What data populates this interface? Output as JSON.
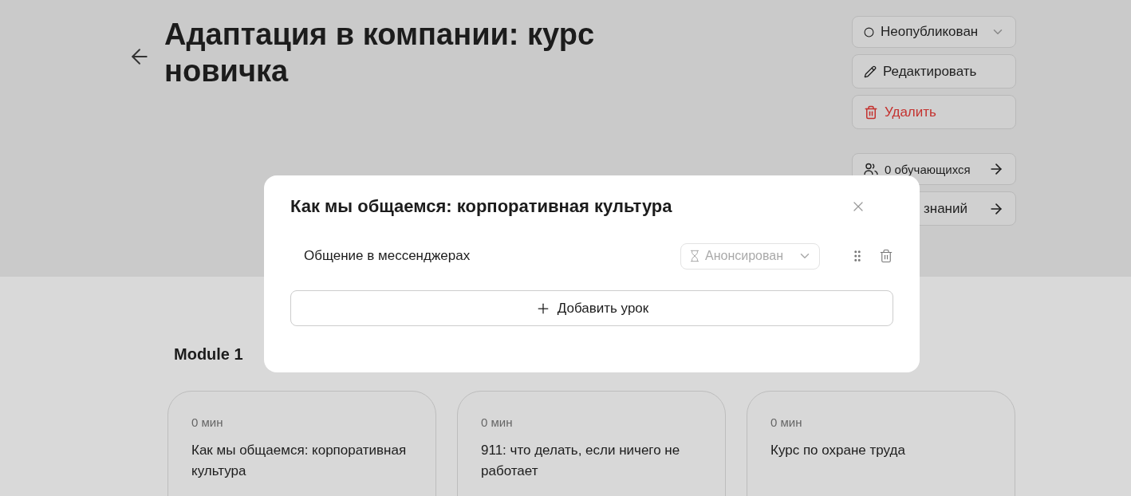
{
  "course": {
    "title": "Адаптация в компании: курс новичка"
  },
  "actions": [
    {
      "kind": "status",
      "label": "Неопубликован"
    },
    {
      "kind": "edit",
      "label": "Редактировать"
    },
    {
      "kind": "delete",
      "label": "Удалить"
    },
    {
      "kind": "learners",
      "label": "0 обучающихся"
    },
    {
      "kind": "partial",
      "label": "знаний"
    }
  ],
  "module": {
    "title": "Module 1",
    "cards": [
      {
        "duration": "0 мин",
        "title": "Как мы общаемся: корпоративная культура"
      },
      {
        "duration": "0 мин",
        "title": "911: что делать, если ничего не работает"
      },
      {
        "duration": "0 мин",
        "title": "Курс по охране труда"
      }
    ]
  },
  "dialog": {
    "title": "Как мы общаемся: корпоративная культура",
    "lessons": [
      {
        "title": "Общение в мессенджерах",
        "status": "Анонсирован"
      }
    ],
    "add_button": "Добавить урок"
  }
}
